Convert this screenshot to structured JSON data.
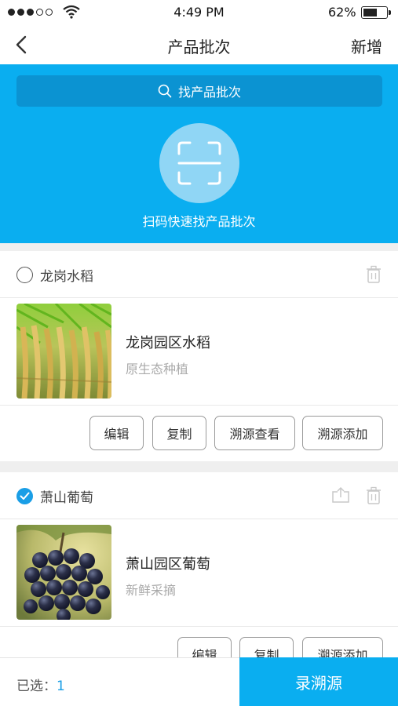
{
  "status_bar": {
    "time": "4:49 PM",
    "battery": "62%",
    "battery_level": 0.62,
    "signal_bars_filled": 3,
    "signal_bars_total": 5
  },
  "nav": {
    "title": "产品批次",
    "add_label": "新增",
    "back_icon": "chevron-left-icon"
  },
  "hero": {
    "search_placeholder": "找产品批次",
    "scan_caption": "扫码快速找产品批次",
    "background_color": "#0aaef0"
  },
  "products": [
    {
      "title": "龙岗水稻",
      "checked": false,
      "name": "龙岗园区水稻",
      "subtitle": "原生态种植",
      "actions": [
        "编辑",
        "复制",
        "溯源查看",
        "溯源添加"
      ]
    },
    {
      "title": "萧山葡萄",
      "checked": true,
      "name": "萧山园区葡萄",
      "subtitle": "新鲜采摘",
      "actions": [
        "编辑",
        "复制",
        "溯源添加"
      ]
    }
  ],
  "footer": {
    "selected_label": "已选：",
    "selected_count": "1",
    "primary_button": "录溯源",
    "accent_color": "#1a9ee6"
  }
}
